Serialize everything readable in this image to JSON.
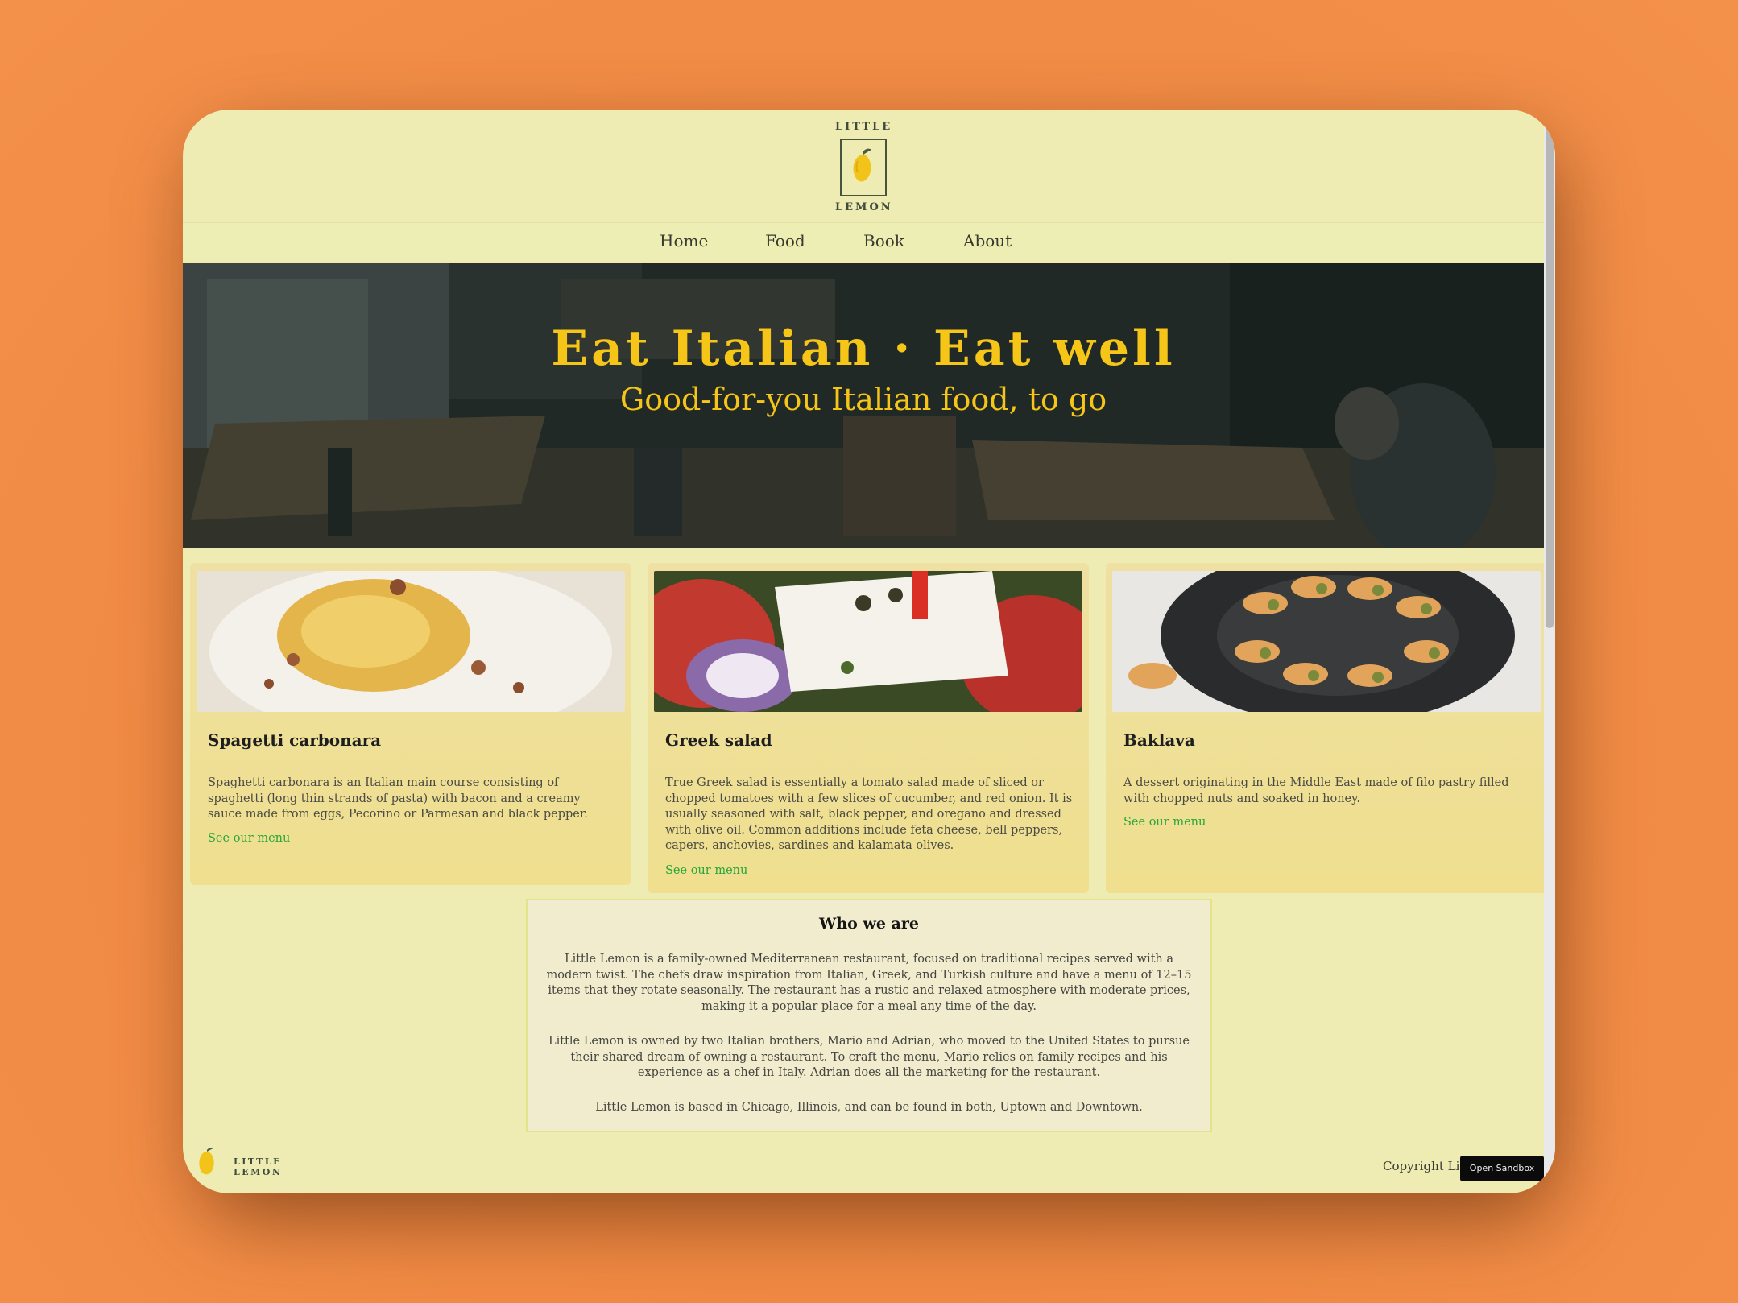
{
  "brand": {
    "logo_top": "LITTLE",
    "logo_bottom": "LEMON",
    "footer_logo_text": "LITTLE LEMON",
    "lemon_color": "#f2c318"
  },
  "nav": {
    "items": [
      {
        "label": "Home"
      },
      {
        "label": "Food"
      },
      {
        "label": "Book"
      },
      {
        "label": "About"
      }
    ]
  },
  "hero": {
    "title": "Eat Italian · Eat well",
    "subtitle": "Good-for-you Italian food, to go",
    "accent_color": "#f5c518"
  },
  "cards": [
    {
      "title": "Spagetti carbonara",
      "description": "Spaghetti carbonara is an Italian main course consisting of spaghetti (long thin strands of pasta) with bacon and a creamy sauce made from eggs, Pecorino or Parmesan and black pepper.",
      "link": "See our menu"
    },
    {
      "title": "Greek salad",
      "description": "True Greek salad is essentially a tomato salad made of sliced or chopped tomatoes with a few slices of cucumber, and red onion. It is usually seasoned with salt, black pepper, and oregano and dressed with olive oil. Common additions include feta cheese, bell peppers, capers, anchovies, sardines and kalamata olives.",
      "link": "See our menu"
    },
    {
      "title": "Baklava",
      "description": "A dessert originating in the Middle East made of filo pastry filled with chopped nuts and soaked in honey.",
      "link": "See our menu"
    }
  ],
  "about": {
    "title": "Who we are",
    "paragraphs": [
      "Little Lemon is a family-owned Mediterranean restaurant, focused on traditional recipes served with a modern twist. The chefs draw inspiration from Italian, Greek, and Turkish culture and have a menu of 12–15 items that they rotate seasonally. The restaurant has a rustic and relaxed atmosphere with moderate prices, making it a popular place for a meal any time of the day.",
      "Little Lemon is owned by two Italian brothers, Mario and Adrian, who moved to the United States to pursue their shared dream of owning a restaurant. To craft the menu, Mario relies on family recipes and his experience as a chef in Italy. Adrian does all the marketing for the restaurant.",
      "Little Lemon is based in Chicago, Illinois, and can be found in both, Uptown and Downtown."
    ]
  },
  "footer": {
    "copyright": "Copyright Little Lemon"
  },
  "sandbox_button": "Open Sandbox",
  "colors": {
    "page_bg": "#eeecb2",
    "card_bg": "#efe0a3",
    "link": "#27a63b",
    "outer_bg": "#f08a44"
  }
}
